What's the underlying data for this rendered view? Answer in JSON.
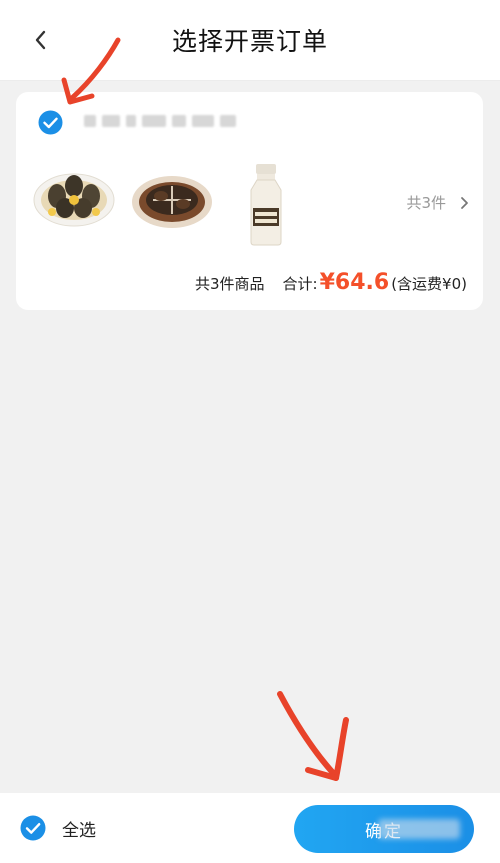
{
  "header": {
    "title": "选择开票订单",
    "back_icon": "chevron-left-icon"
  },
  "order": {
    "checked": true,
    "order_id": "■■■■ 54 13: ■■■",
    "products": [
      {
        "name": "seafood-platter-photo"
      },
      {
        "name": "braised-crab-photo"
      },
      {
        "name": "milk-bottle-photo"
      }
    ],
    "count_label": "共3件",
    "summary": {
      "items_label": "共3件商品",
      "total_label": "合计:",
      "price": "¥64.6",
      "shipping": "(含运费¥0)"
    }
  },
  "footer": {
    "select_all_label": "全选",
    "select_all_checked": true,
    "confirm_label": "确定"
  },
  "colors": {
    "accent": "#1b8fe6",
    "price": "#f4502a",
    "annotation": "#e8432a",
    "background": "#f1f1f1"
  }
}
